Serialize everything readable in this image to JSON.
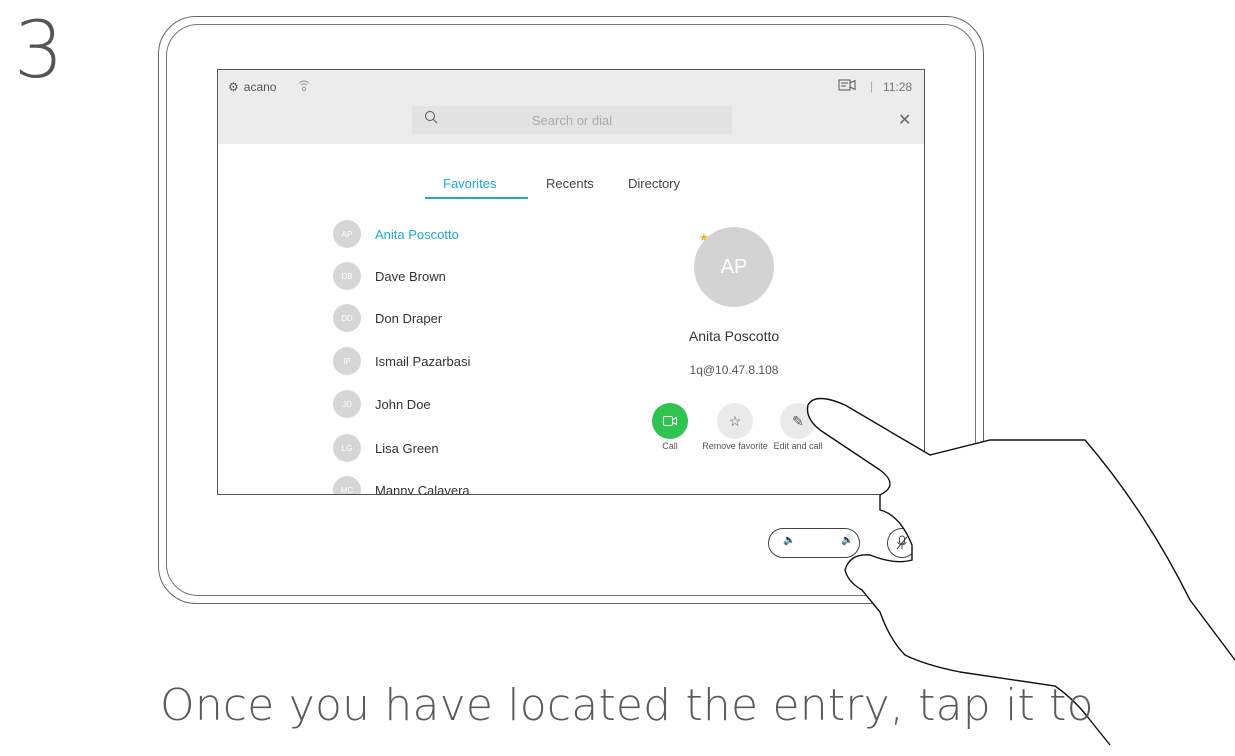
{
  "step_number": "3",
  "caption": "Once you have located the entry, tap it to",
  "status_bar": {
    "brand": "acano",
    "time": "11:28",
    "separator": "|"
  },
  "search": {
    "placeholder": "Search or dial"
  },
  "tabs": [
    {
      "label": "Favorites",
      "active": true
    },
    {
      "label": "Recents",
      "active": false
    },
    {
      "label": "Directory",
      "active": false
    }
  ],
  "contacts": [
    {
      "initials": "AP",
      "name": "Anita Poscotto",
      "active": true
    },
    {
      "initials": "DB",
      "name": "Dave Brown"
    },
    {
      "initials": "DD",
      "name": "Don Draper"
    },
    {
      "initials": "IP",
      "name": "Ismail Pazarbasi"
    },
    {
      "initials": "JD",
      "name": "John Doe"
    },
    {
      "initials": "LG",
      "name": "Lisa Green"
    },
    {
      "initials": "MC",
      "name": "Manny Calavera"
    }
  ],
  "detail": {
    "initials": "AP",
    "name": "Anita Poscotto",
    "uri": "1q@10.47.8.108"
  },
  "actions": [
    {
      "label": "Call",
      "icon": "video-camera-icon"
    },
    {
      "label": "Remove favorite",
      "icon": "star-icon"
    },
    {
      "label": "Edit and call",
      "icon": "pencil-icon"
    }
  ],
  "colors": {
    "accent": "#1fa9d2",
    "call": "#2ec44e",
    "favorite": "#f2b31d"
  }
}
